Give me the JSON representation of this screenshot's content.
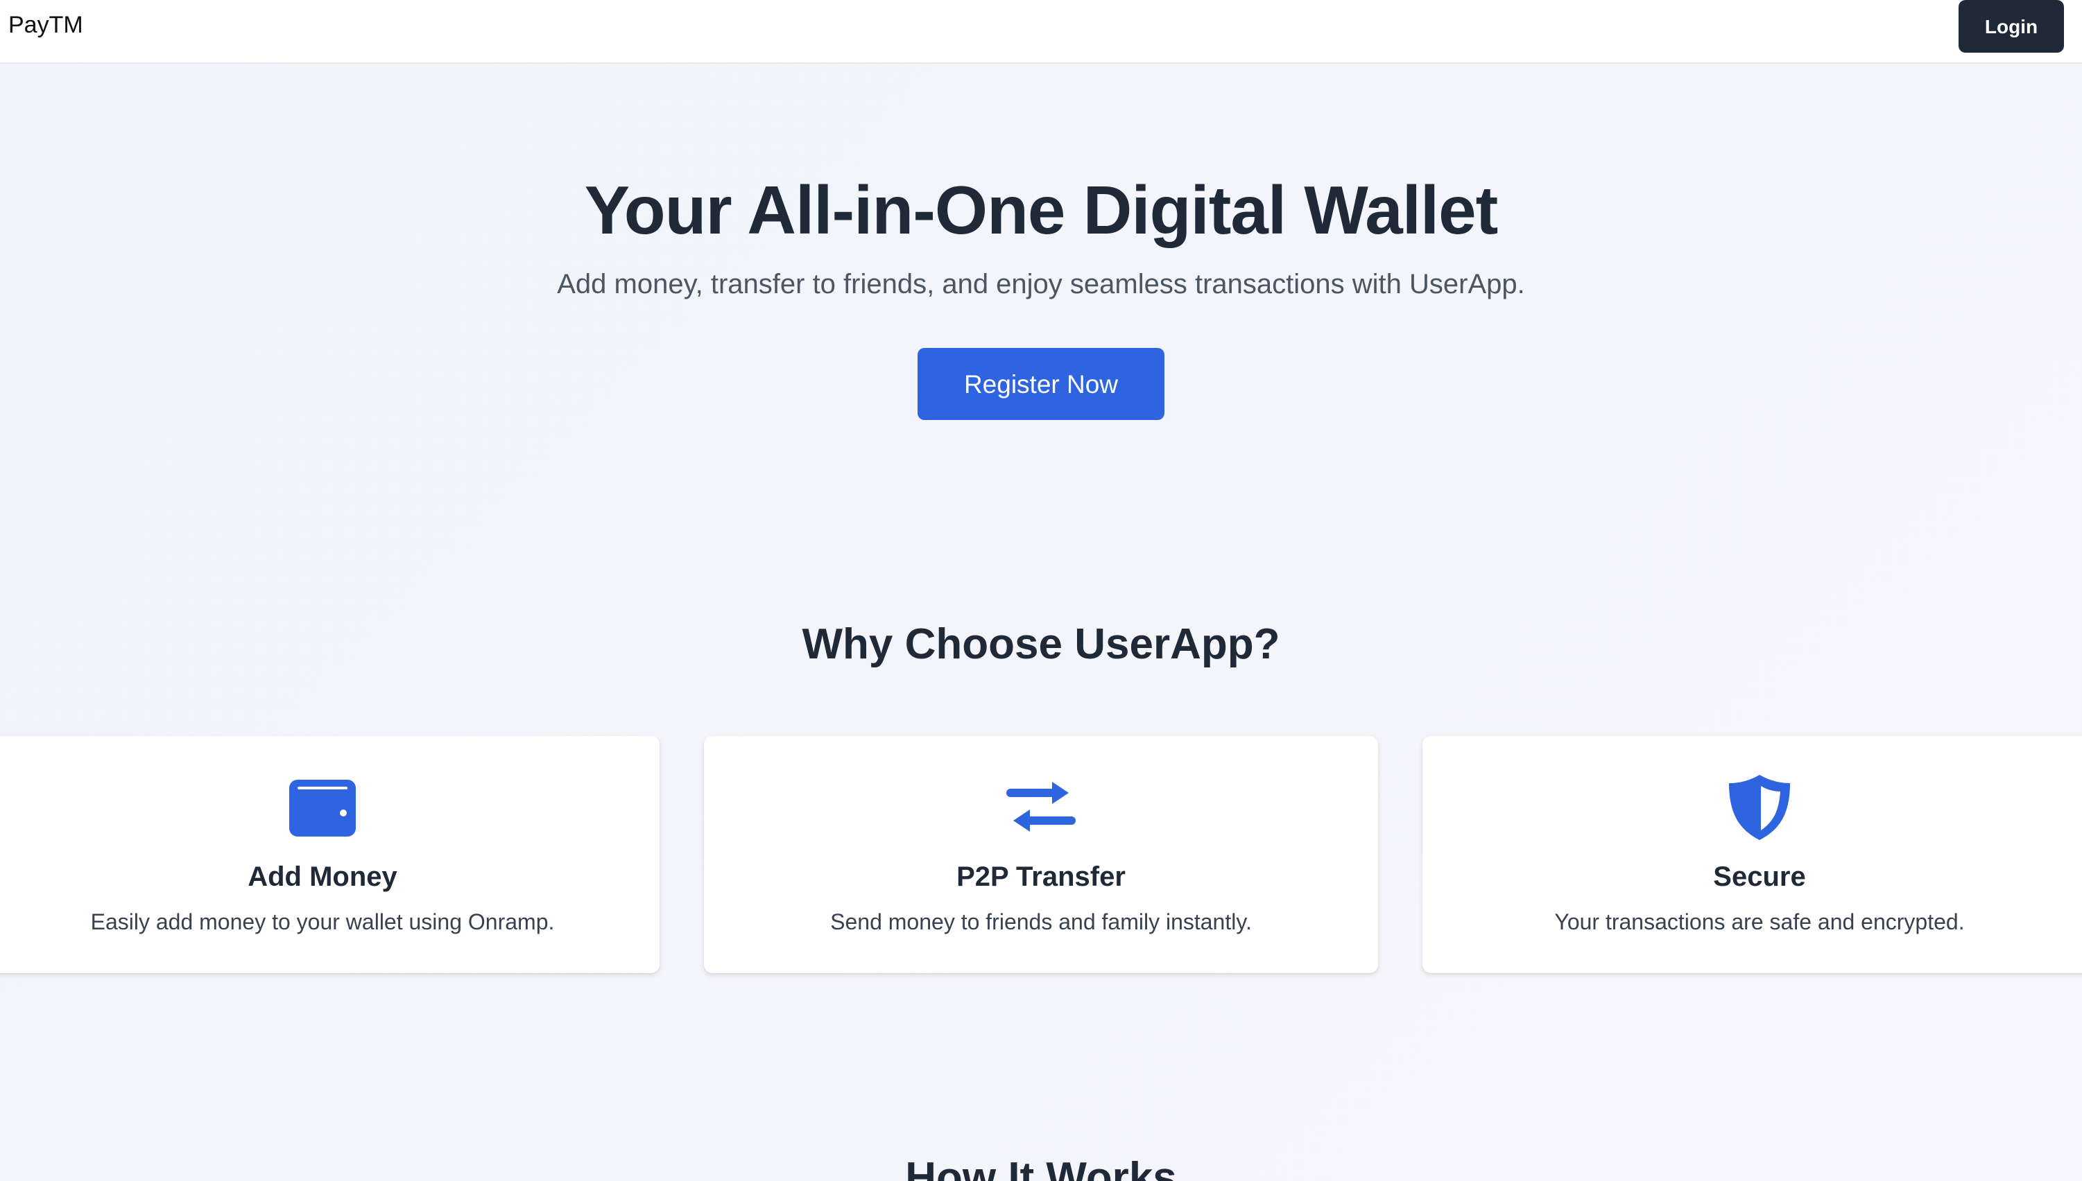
{
  "navbar": {
    "brand": "PayTM",
    "login_label": "Login"
  },
  "hero": {
    "title": "Your All-in-One Digital Wallet",
    "subtitle": "Add money, transfer to friends, and enjoy seamless transactions with UserApp.",
    "cta_label": "Register Now"
  },
  "why": {
    "title": "Why Choose UserApp?",
    "features": [
      {
        "icon": "wallet-icon",
        "title": "Add Money",
        "description": "Easily add money to your wallet using Onramp."
      },
      {
        "icon": "transfer-arrows-icon",
        "title": "P2P Transfer",
        "description": "Send money to friends and family instantly."
      },
      {
        "icon": "shield-icon",
        "title": "Secure",
        "description": "Your transactions are safe and encrypted."
      }
    ]
  },
  "how": {
    "title": "How It Works"
  },
  "colors": {
    "primary": "#2f64e0",
    "dark": "#1f2937",
    "background": "#f2f4fb"
  }
}
